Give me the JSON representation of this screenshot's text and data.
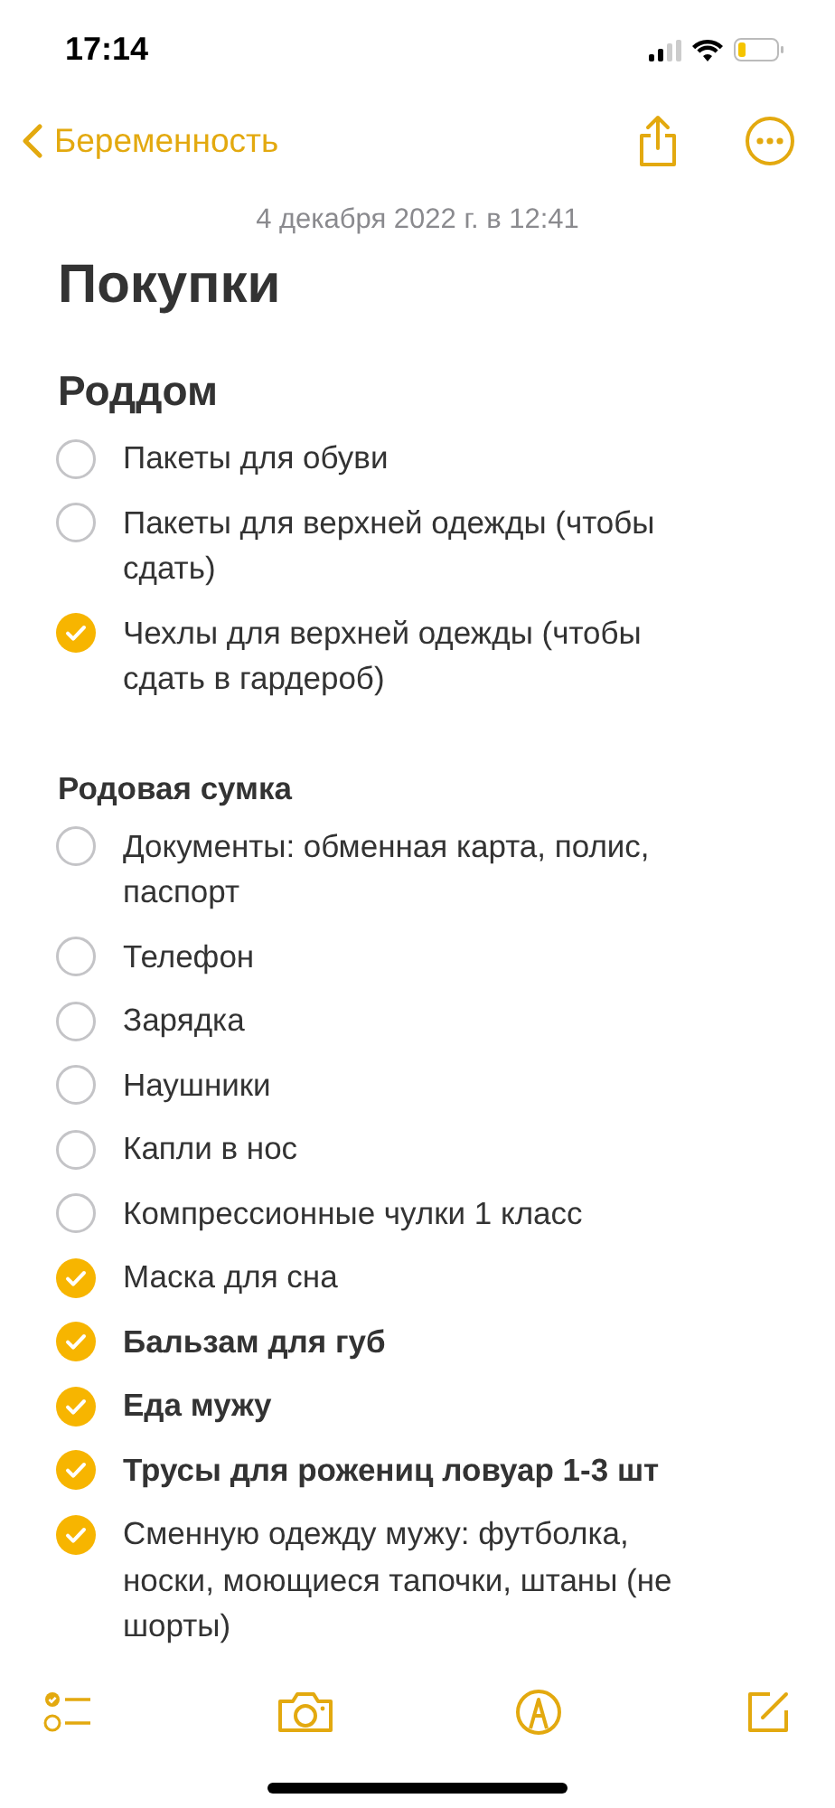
{
  "status_bar": {
    "time": "17:14"
  },
  "nav": {
    "back_label": "Беременность"
  },
  "note": {
    "date": "4 декабря 2022 г. в 12:41",
    "title": "Покупки",
    "sections": [
      {
        "kind": "heading",
        "title": "Роддом",
        "items": [
          {
            "text": "Пакеты для обуви",
            "checked": false,
            "bold": false
          },
          {
            "text": "Пакеты для верхней одежды (чтобы сдать)",
            "checked": false,
            "bold": false
          },
          {
            "text": "Чехлы для верхней одежды (чтобы сдать в гардероб)",
            "checked": true,
            "bold": false
          }
        ]
      },
      {
        "kind": "subheading",
        "title": "Родовая сумка",
        "items": [
          {
            "text": "Документы: обменная карта, полис, паспорт",
            "checked": false,
            "bold": false
          },
          {
            "text": "Телефон",
            "checked": false,
            "bold": false
          },
          {
            "text": "Зарядка",
            "checked": false,
            "bold": false
          },
          {
            "text": "Наушники",
            "checked": false,
            "bold": false
          },
          {
            "text": "Капли в нос",
            "checked": false,
            "bold": false
          },
          {
            "text": "Компрессионные чулки 1 класс",
            "checked": false,
            "bold": false
          },
          {
            "text": "Маска для сна",
            "checked": true,
            "bold": false
          },
          {
            "text": "Бальзам для губ",
            "checked": true,
            "bold": true
          },
          {
            "text": "Еда мужу",
            "checked": true,
            "bold": true
          },
          {
            "text": "Трусы для рожениц ловуар 1-3 шт",
            "checked": true,
            "bold": true
          },
          {
            "text": "Сменную одежду мужу: футболка, носки, моющиеся тапочки, штаны (не шорты)",
            "checked": true,
            "bold": false
          }
        ]
      }
    ]
  }
}
